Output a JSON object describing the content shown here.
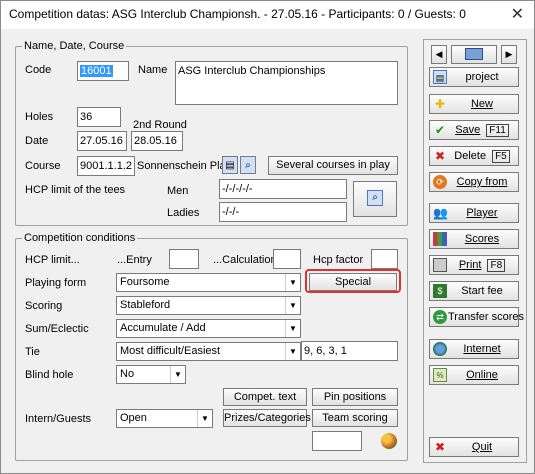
{
  "window": {
    "title": "Competition datas: ASG Interclub Championsh. - 27.05.16 - Participants: 0 / Guests: 0",
    "close": "✕"
  },
  "group1": {
    "caption": "Name, Date, Course",
    "code_label": "Code",
    "code_value": "16001",
    "name_label": "Name",
    "name_value": "ASG Interclub Championships",
    "holes_label": "Holes",
    "holes_value": "36",
    "second_round_label": "2nd Round",
    "date_label": "Date",
    "date_value": "27.05.16",
    "second_round_value": "28.05.16",
    "course_label": "Course",
    "course_code": "9001.1.1.2",
    "course_name": "Sonnenschein Pla",
    "several_courses_button": "Several courses in play",
    "hcp_limit_tees_label": "HCP limit of the tees",
    "men_label": "Men",
    "men_value": "-/-/-/-/-",
    "ladies_label": "Ladies",
    "ladies_value": "-/-/-"
  },
  "group2": {
    "caption": "Competition conditions",
    "hcp_limit_label": "HCP limit...",
    "entry_label": "...Entry",
    "calculation_label": "...Calculation",
    "hcp_factor_label": "Hcp factor",
    "playing_form_label": "Playing form",
    "playing_form_value": "Foursome",
    "special_button": "Special",
    "scoring_label": "Scoring",
    "scoring_value": "Stableford",
    "sum_eclectic_label": "Sum/Eclectic",
    "sum_eclectic_value": "Accumulate / Add",
    "tie_label": "Tie",
    "tie_value": "Most difficult/Easiest",
    "tie_holes": "9, 6, 3, 1",
    "blind_hole_label": "Blind hole",
    "blind_hole_value": "No",
    "compet_text_button": "Compet. text",
    "pin_positions_button": "Pin positions",
    "intern_guests_label": "Intern/Guests",
    "intern_guests_value": "Open",
    "prizes_button": "Prizes/Categories",
    "team_scoring_button": "Team scoring"
  },
  "right": {
    "project": "project",
    "new": "New",
    "save": "Save",
    "save_key": "F11",
    "delete": "Delete",
    "delete_key": "F5",
    "copy_from": "Copy from",
    "player": "Player",
    "scores": "Scores",
    "print": "Print",
    "print_key": "F8",
    "start_fee": "Start fee",
    "transfer_scores": "Transfer scores",
    "internet": "Internet",
    "online": "Online",
    "quit": "Quit"
  },
  "icons": {
    "nav_prev": "◀",
    "nav_next": "▶",
    "dropdown": "▼",
    "new": "✚",
    "save": "✔",
    "delete": "✖",
    "quit": "✖",
    "colors": {
      "new": "#e6b800",
      "save": "#1a8f1a",
      "delete": "#d02020",
      "quit": "#d02020",
      "highlight": "#e03030"
    }
  }
}
